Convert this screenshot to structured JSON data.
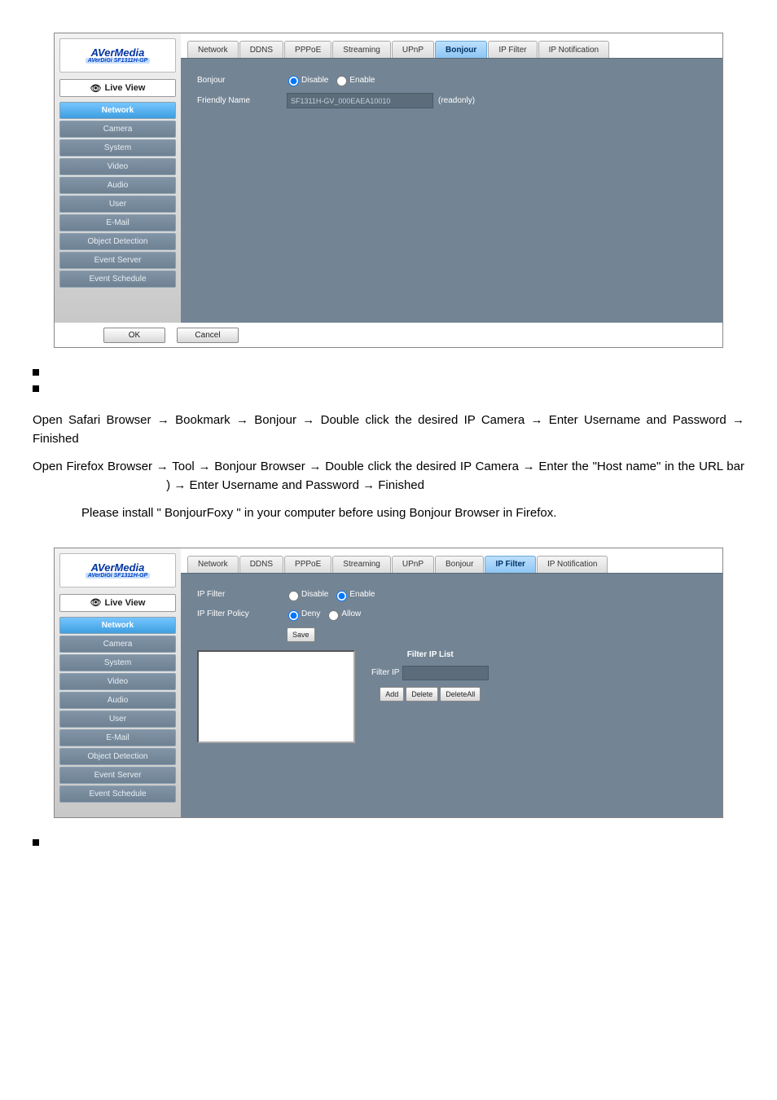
{
  "logo": {
    "top": "AVerMedia",
    "bot": "AVerDiGi SF1311H-GP"
  },
  "live_view": "Live View",
  "nav": [
    "Network",
    "Camera",
    "System",
    "Video",
    "Audio",
    "User",
    "E-Mail",
    "Object Detection",
    "Event Server",
    "Event Schedule"
  ],
  "tabs": [
    "Network",
    "DDNS",
    "PPPoE",
    "Streaming",
    "UPnP",
    "Bonjour",
    "IP Filter",
    "IP Notification"
  ],
  "screen1": {
    "active_tab_index": 5,
    "bonjour_label": "Bonjour",
    "disable": "Disable",
    "enable": "Enable",
    "friendly_label": "Friendly Name",
    "friendly_value": "SF1311H-GV_000EAEA10010",
    "readonly": "(readonly)",
    "ok": "OK",
    "cancel": "Cancel"
  },
  "text": {
    "p1": "Open Safari Browser → Bookmark → Bonjour → Double click the desired IP Camera → Enter Username and Password → Finished",
    "p2a": "Open Firefox Browser → Tool → Bonjour Browser → Double click the desired IP Camera → Enter the \"Host   name\" in the URL bar",
    "p2b": ") → Enter Username and Password → Finished",
    "p3": "Please install \" BonjourFoxy \" in your computer before using Bonjour Browser in Firefox."
  },
  "screen2": {
    "active_tab_index": 6,
    "ipfilter_label": "IP Filter",
    "disable": "Disable",
    "enable": "Enable",
    "policy_label": "IP Filter Policy",
    "deny": "Deny",
    "allow": "Allow",
    "save": "Save",
    "list_header": "Filter IP List",
    "filter_ip": "Filter IP",
    "add": "Add",
    "delete": "Delete",
    "delete_all": "DeleteAll"
  }
}
